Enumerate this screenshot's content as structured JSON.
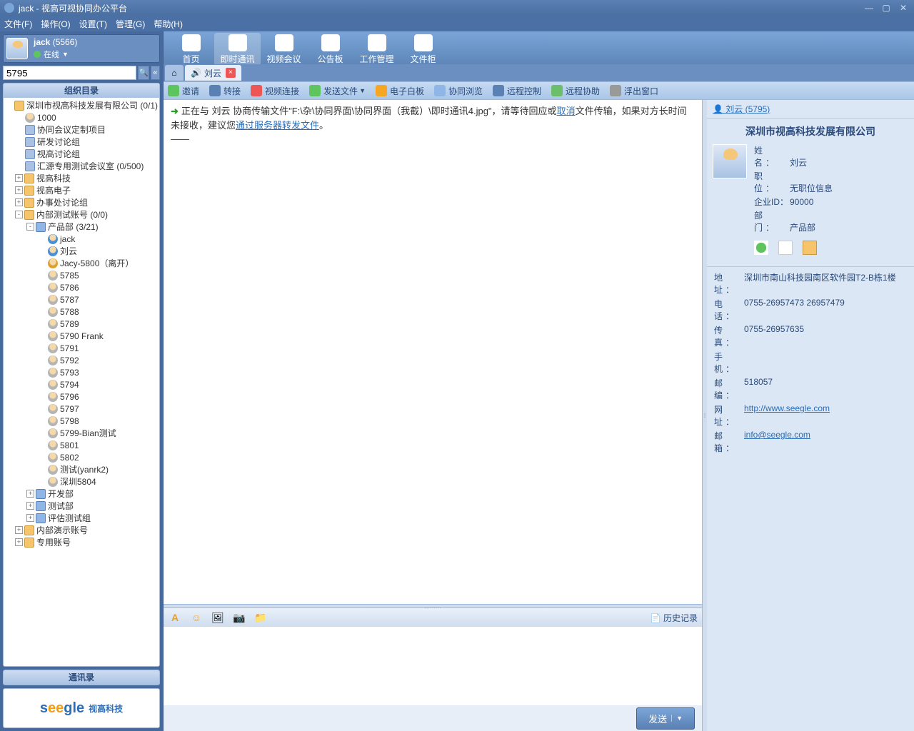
{
  "titlebar": {
    "app_title": "jack - 视高可视协同办公平台"
  },
  "menubar": [
    "文件(F)",
    "操作(O)",
    "设置(T)",
    "管理(G)",
    "帮助(H)"
  ],
  "user": {
    "name": "jack",
    "id": "(5566)",
    "status": "在线"
  },
  "search": {
    "value": "5795"
  },
  "panels": {
    "org_dir": "组织目录",
    "contacts": "通讯录"
  },
  "tree": {
    "root": "深圳市视高科技发展有限公司 (0/1)",
    "n_1000": "1000",
    "n_proj": "协同会议定制项目",
    "n_rd": "研发讨论组",
    "n_sg": "视高讨论组",
    "n_hy": "汇源专用测试会议室 (0/500)",
    "n_sgkj": "视高科技",
    "n_sgdz": "视高电子",
    "n_bsc": "办事处讨论组",
    "n_nbcs": "内部测试账号 (0/0)",
    "n_cpb": "产品部 (3/21)",
    "n_kfb": "开发部",
    "n_csb": "测试部",
    "n_pgcs": "评估测试组",
    "n_nbys": "内部演示账号",
    "n_zy": "专用账号",
    "people": {
      "jack": "jack",
      "liuyun": "刘云",
      "jacy": "Jacy-5800（离开）",
      "p5785": "5785",
      "p5786": "5786",
      "p5787": "5787",
      "p5788": "5788",
      "p5789": "5789",
      "p5790": "5790 Frank",
      "p5791": "5791",
      "p5792": "5792",
      "p5793": "5793",
      "p5794": "5794",
      "p5796": "5796",
      "p5797": "5797",
      "p5798": "5798",
      "p5799": "5799-Bian测试",
      "p5801": "5801",
      "p5802": "5802",
      "ptest": "测试(yanrk2)",
      "psz": "深圳5804"
    }
  },
  "main_tabs": {
    "home": "首页",
    "im": "即时通讯",
    "video": "视频会议",
    "board": "公告板",
    "work": "工作管理",
    "files": "文件柜"
  },
  "chat_tab": {
    "name": "刘云"
  },
  "toolbar": {
    "invite": "邀请",
    "transfer": "转接",
    "videolink": "视频连接",
    "sendfile": "发送文件",
    "eboard": "电子白板",
    "cobrowse": "协同浏览",
    "remote": "远程控制",
    "assist": "远程协助",
    "float": "浮出窗口"
  },
  "log": {
    "pre": "正在与 刘云 协商传输文件\"F:\\杂\\协同界面\\协同界面（我截）\\即时通讯4.jpg\"，请等待回应或",
    "cancel": "取消",
    "mid": "文件传输，如果对方长时间未接收，建议您",
    "forward": "通过服务器转发文件",
    "end": "。",
    "sep": "——"
  },
  "input_bar": {
    "history": "历史记录"
  },
  "send": {
    "label": "发送"
  },
  "info": {
    "header": "刘云 (5795)",
    "company": "深圳市视高科技发展有限公司",
    "fields": {
      "name_l": "姓　名：",
      "name_v": "刘云",
      "pos_l": "职　位：",
      "pos_v": "无职位信息",
      "eid_l": "企业ID：",
      "eid_v": "90000",
      "dept_l": "部　门：",
      "dept_v": "产品部"
    },
    "details": {
      "addr_l": "地　址：",
      "addr_v": "深圳市南山科技园南区软件园T2-B栋1楼",
      "tel_l": "电　话：",
      "tel_v": "0755-26957473 26957479",
      "fax_l": "传　真：",
      "fax_v": "0755-26957635",
      "mob_l": "手　机：",
      "mob_v": "",
      "zip_l": "邮　编：",
      "zip_v": "518057",
      "web_l": "网　址：",
      "web_v": "http://www.seegle.com",
      "mail_l": "邮　箱：",
      "mail_v": "info@seegle.com"
    }
  },
  "logo": {
    "brand": "seegle",
    "cn": "视高科技"
  }
}
